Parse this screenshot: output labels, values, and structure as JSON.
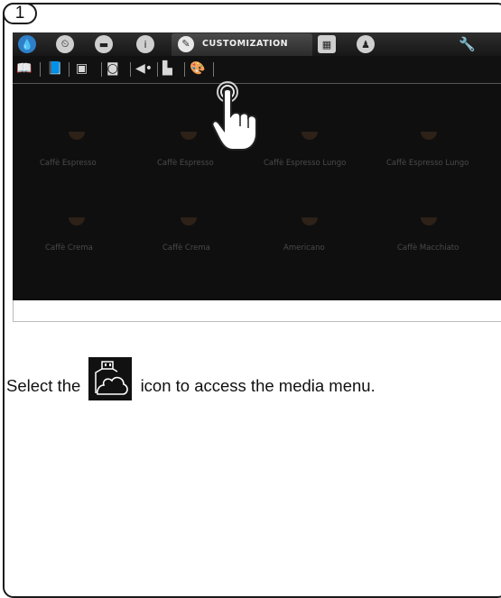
{
  "step": {
    "number": "1"
  },
  "screen": {
    "topbar": {
      "active_tab_label": "CUSTOMIZATION",
      "icons": [
        "water-drop-icon",
        "clock-icon",
        "cup-icon",
        "info-icon",
        "pencil-icon",
        "keyboard-icon",
        "user-icon",
        "wrench-icon"
      ]
    },
    "subbar": {
      "icons": [
        "book-icon",
        "recipe-book-icon",
        "screen-icon",
        "screensaver-icon",
        "speaker-icon",
        "usb-media-icon",
        "palette-icon"
      ]
    },
    "products": [
      {
        "label": "Caffè Espresso"
      },
      {
        "label": "Caffè Espresso"
      },
      {
        "label": "Caffè Espresso Lungo"
      },
      {
        "label": "Caffè Espresso Lungo"
      },
      {
        "label": "Caffè Crema"
      },
      {
        "label": "Caffè Crema"
      },
      {
        "label": "Americano"
      },
      {
        "label": "Caffè Macchiato"
      }
    ]
  },
  "instruction": {
    "before": "Select the",
    "after": "icon to access the media menu."
  }
}
